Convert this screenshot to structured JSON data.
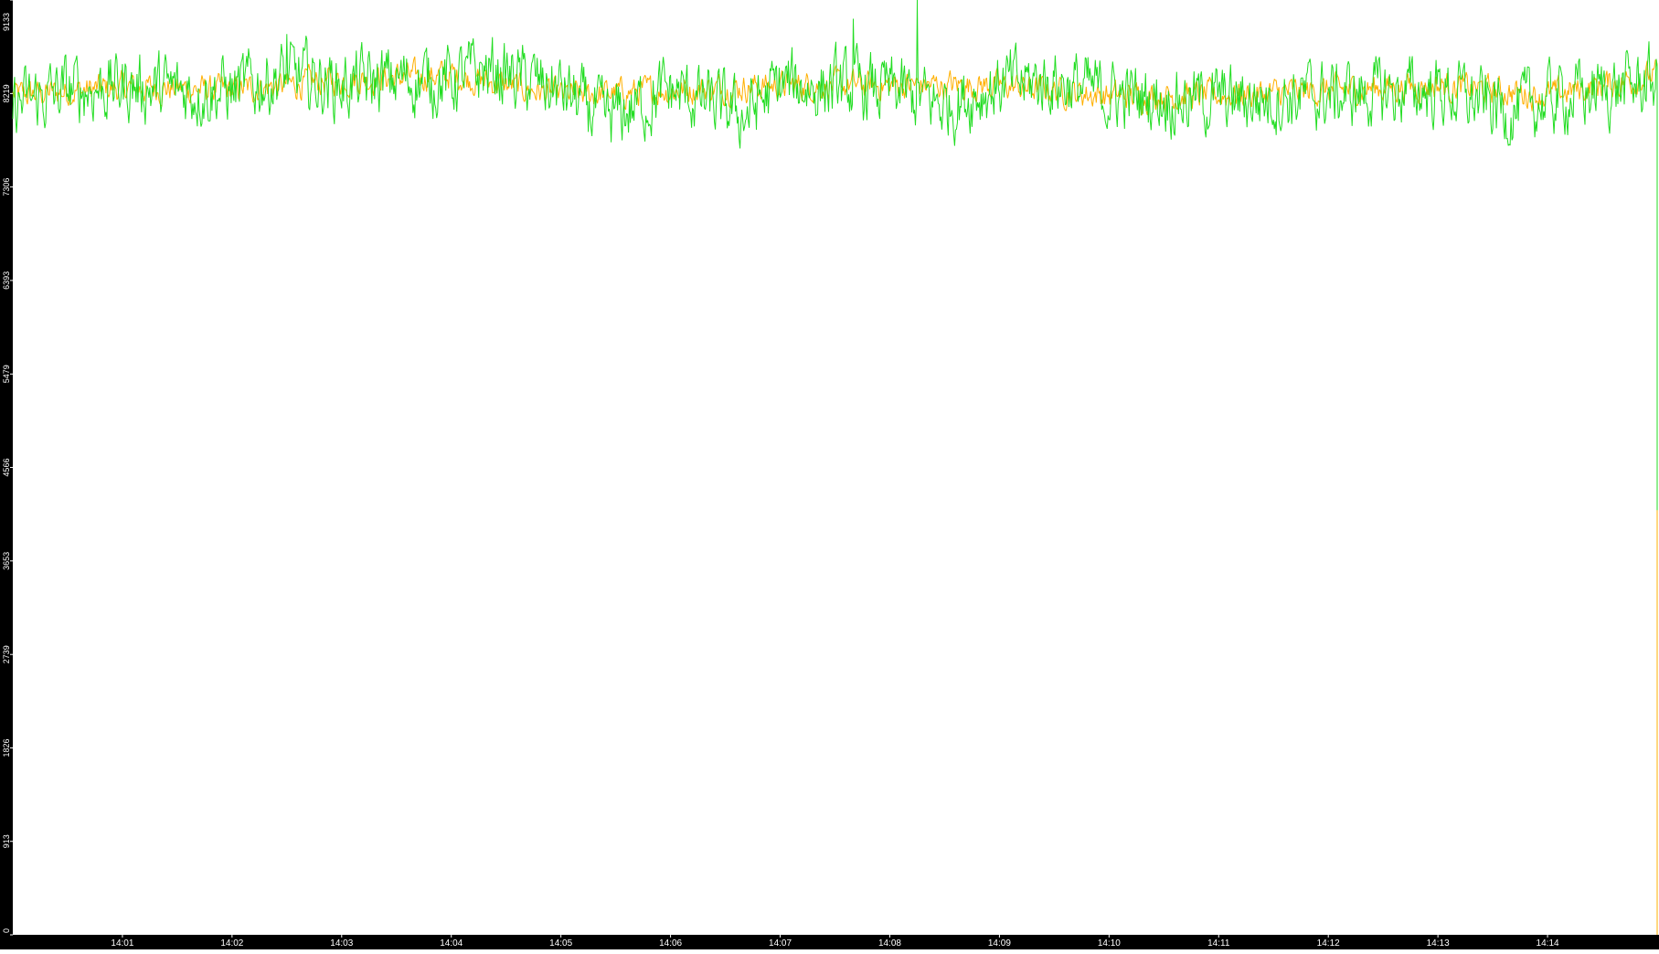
{
  "chart_data": {
    "type": "line",
    "title": "",
    "xlabel": "",
    "ylabel": "",
    "x_domain": [
      "14:00",
      "14:15"
    ],
    "ylim": [
      0,
      9133
    ],
    "y_ticks": [
      {
        "value": 0,
        "label": "0"
      },
      {
        "value": 913,
        "label": "913"
      },
      {
        "value": 1826,
        "label": "1826"
      },
      {
        "value": 2739,
        "label": "2739"
      },
      {
        "value": 3653,
        "label": "3653"
      },
      {
        "value": 4566,
        "label": "4566"
      },
      {
        "value": 5479,
        "label": "5479"
      },
      {
        "value": 6393,
        "label": "6393"
      },
      {
        "value": 7306,
        "label": "7306"
      },
      {
        "value": 8219,
        "label": "8219"
      },
      {
        "value": 9133,
        "label": "9133"
      }
    ],
    "x_ticks": [
      "14:01",
      "14:02",
      "14:03",
      "14:04",
      "14:05",
      "14:06",
      "14:07",
      "14:08",
      "14:09",
      "14:10",
      "14:11",
      "14:12",
      "14:13",
      "14:14"
    ],
    "series": [
      {
        "color": "#22dd22",
        "baseline": 8200,
        "amplitude": 380,
        "envelope": [
          {
            "t": "14:00",
            "mean": 8100
          },
          {
            "t": "14:00:30",
            "mean": 8250
          },
          {
            "t": "14:01",
            "mean": 8300
          },
          {
            "t": "14:01:30",
            "mean": 8250
          },
          {
            "t": "14:02",
            "mean": 8250
          },
          {
            "t": "14:02:30",
            "mean": 8400
          },
          {
            "t": "14:03",
            "mean": 8300
          },
          {
            "t": "14:03:30",
            "mean": 8350
          },
          {
            "t": "14:04",
            "mean": 8350
          },
          {
            "t": "14:04:20",
            "mean": 8450
          },
          {
            "t": "14:05",
            "mean": 8250
          },
          {
            "t": "14:05:25",
            "mean": 7950
          },
          {
            "t": "14:06",
            "mean": 8250
          },
          {
            "t": "14:06:40",
            "mean": 8000
          },
          {
            "t": "14:07",
            "mean": 8300
          },
          {
            "t": "14:08",
            "mean": 8250
          },
          {
            "t": "14:08:30",
            "mean": 8100
          },
          {
            "t": "14:09",
            "mean": 8300
          },
          {
            "t": "14:09:30",
            "mean": 8350
          },
          {
            "t": "14:10",
            "mean": 8200
          },
          {
            "t": "14:11",
            "mean": 8150
          },
          {
            "t": "14:12",
            "mean": 8200
          },
          {
            "t": "14:13",
            "mean": 8250
          },
          {
            "t": "14:13:40",
            "mean": 8050
          },
          {
            "t": "14:14",
            "mean": 8150
          },
          {
            "t": "14:15",
            "mean": 8350
          }
        ],
        "spikes": [
          {
            "t": "14:08:15",
            "value": 9133
          },
          {
            "t": "14:07:40",
            "value": 8950
          },
          {
            "t": "14:02:30",
            "value": 8800
          }
        ],
        "tail_value": 4150
      },
      {
        "color": "#ffb000",
        "baseline": 8250,
        "amplitude": 160,
        "envelope": [
          {
            "t": "14:00",
            "mean": 8200
          },
          {
            "t": "14:01",
            "mean": 8280
          },
          {
            "t": "14:02",
            "mean": 8250
          },
          {
            "t": "14:03",
            "mean": 8350
          },
          {
            "t": "14:04",
            "mean": 8400
          },
          {
            "t": "14:05",
            "mean": 8200
          },
          {
            "t": "14:06",
            "mean": 8250
          },
          {
            "t": "14:07",
            "mean": 8300
          },
          {
            "t": "14:08",
            "mean": 8300
          },
          {
            "t": "14:09",
            "mean": 8300
          },
          {
            "t": "14:10",
            "mean": 8200
          },
          {
            "t": "14:11",
            "mean": 8200
          },
          {
            "t": "14:12",
            "mean": 8250
          },
          {
            "t": "14:13",
            "mean": 8300
          },
          {
            "t": "14:14",
            "mean": 8200
          },
          {
            "t": "14:15",
            "mean": 8400
          }
        ],
        "tail_value": 0
      }
    ],
    "colors": {
      "background": "#ffffff",
      "axis_band": "#000000",
      "axis_text": "#ffffff"
    },
    "grid": false,
    "legend": "none"
  }
}
